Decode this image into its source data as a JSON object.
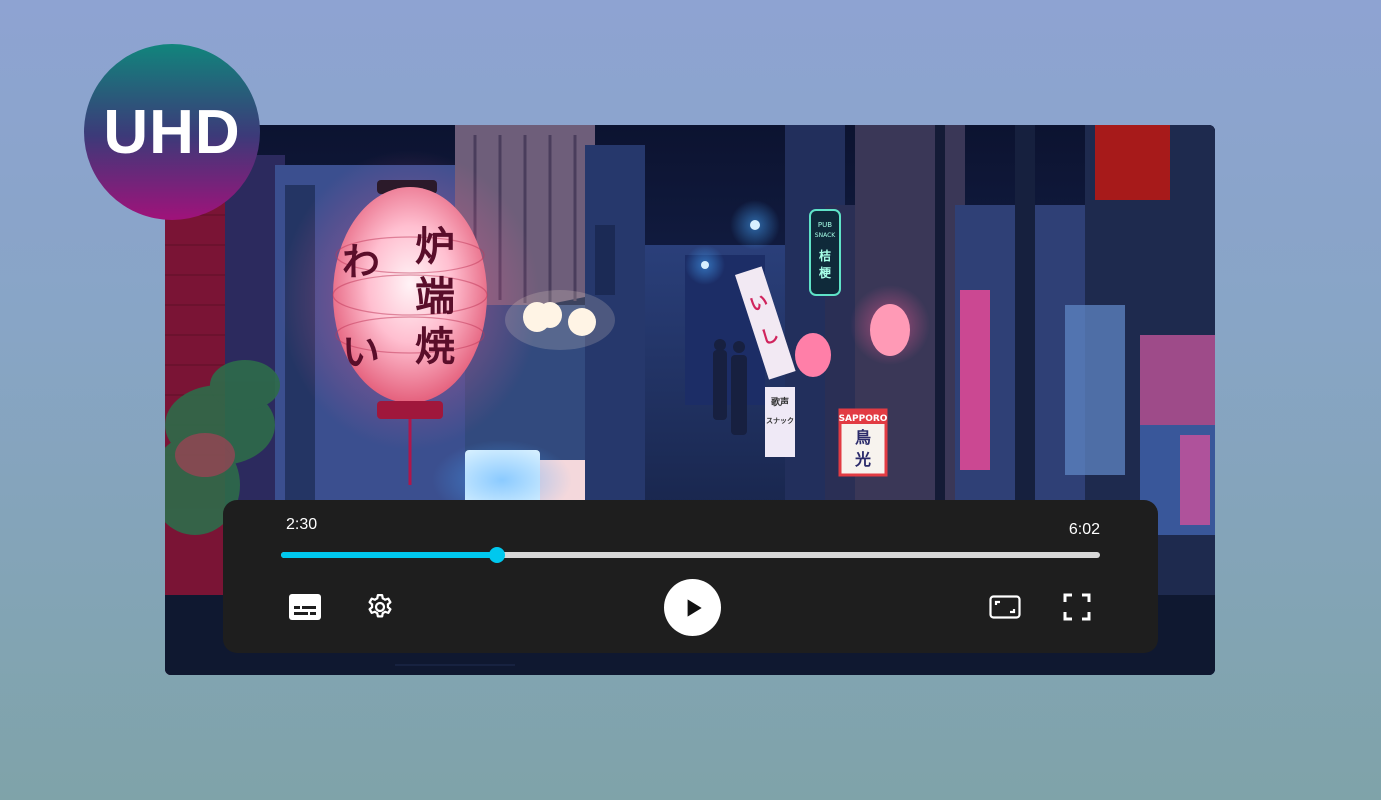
{
  "badge": {
    "label": "UHD"
  },
  "player": {
    "current_time": "2:30",
    "total_time": "6:02",
    "progress_fraction": 0.2637,
    "accent_color": "#00c8ee"
  },
  "controls": {
    "left": [
      {
        "name": "subtitles-button",
        "icon": "subtitles-icon"
      },
      {
        "name": "settings-button",
        "icon": "gear-icon"
      }
    ],
    "center": {
      "name": "play-button",
      "icon": "play-icon"
    },
    "right": [
      {
        "name": "aspect-ratio-button",
        "icon": "aspect-ratio-icon"
      },
      {
        "name": "fullscreen-button",
        "icon": "fullscreen-icon"
      }
    ]
  },
  "video": {
    "lantern_text": "炉端焼",
    "lantern_side_text": "わい",
    "signs": [
      {
        "text": "SAPPORO"
      },
      {
        "text": "鳥光"
      },
      {
        "text": "PUB SNACK"
      },
      {
        "text": "桔梗"
      },
      {
        "text": "歌声 スナック"
      },
      {
        "text": "いし"
      }
    ]
  }
}
